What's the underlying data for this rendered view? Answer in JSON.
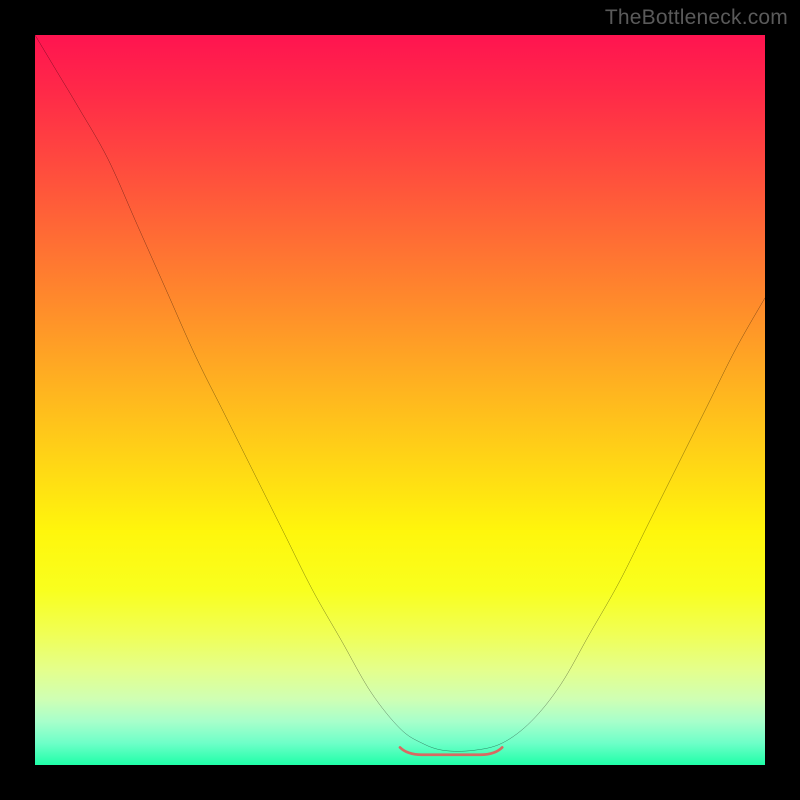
{
  "watermark": "TheBottleneck.com",
  "chart_data": {
    "type": "line",
    "title": "",
    "xlabel": "",
    "ylabel": "",
    "xlim": [
      0,
      100
    ],
    "ylim": [
      0,
      100
    ],
    "grid": false,
    "gradient_stops": [
      {
        "pos": 0,
        "color": "#ff1450"
      },
      {
        "pos": 8,
        "color": "#ff2a48"
      },
      {
        "pos": 18,
        "color": "#ff4b3e"
      },
      {
        "pos": 28,
        "color": "#ff6d34"
      },
      {
        "pos": 38,
        "color": "#ff8f2a"
      },
      {
        "pos": 48,
        "color": "#ffb220"
      },
      {
        "pos": 58,
        "color": "#ffd416"
      },
      {
        "pos": 68,
        "color": "#fff60c"
      },
      {
        "pos": 76,
        "color": "#f9ff1e"
      },
      {
        "pos": 82,
        "color": "#f0ff55"
      },
      {
        "pos": 87,
        "color": "#e4ff8c"
      },
      {
        "pos": 91,
        "color": "#cfffb4"
      },
      {
        "pos": 94,
        "color": "#a8ffcb"
      },
      {
        "pos": 97,
        "color": "#6effc8"
      },
      {
        "pos": 100,
        "color": "#1fffa8"
      }
    ],
    "series": [
      {
        "name": "bottleneck-curve",
        "color": "#000000",
        "x": [
          0,
          3,
          6,
          10,
          14,
          18,
          22,
          26,
          30,
          34,
          38,
          42,
          46,
          50,
          53,
          56,
          60,
          64,
          68,
          72,
          76,
          80,
          84,
          88,
          92,
          96,
          100
        ],
        "y": [
          100,
          95,
          90,
          83,
          74,
          65,
          56,
          48,
          40,
          32,
          24,
          17,
          10,
          5,
          3,
          2,
          2,
          3,
          6,
          11,
          18,
          25,
          33,
          41,
          49,
          57,
          64
        ]
      }
    ],
    "valley_highlight": {
      "x_start": 50,
      "x_end": 64,
      "y": 2,
      "thickness": 2.7,
      "color": "#d86a62"
    }
  }
}
